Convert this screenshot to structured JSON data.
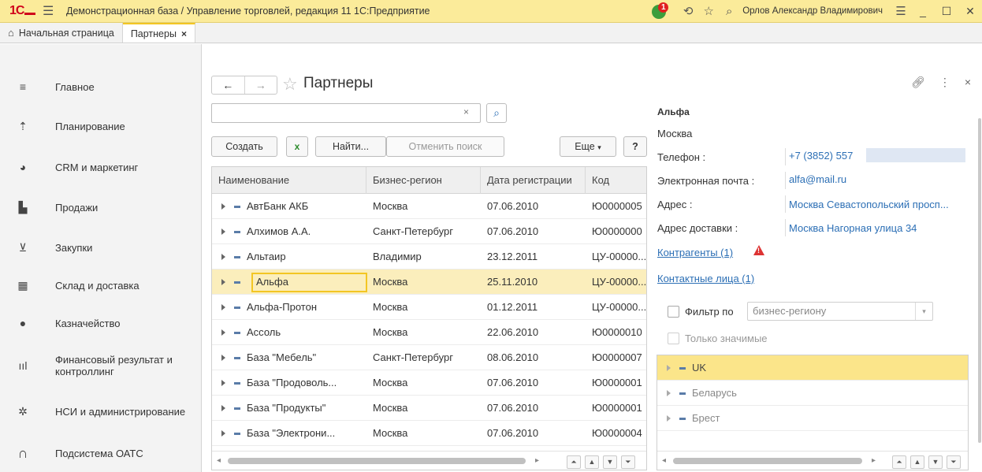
{
  "titlebar": {
    "title": "Демонстрационная база / Управление торговлей, редакция 11 1С:Предприятие",
    "notification_count": "1",
    "user": "Орлов Александр Владимирович"
  },
  "tabs": [
    {
      "label": "Начальная страница"
    },
    {
      "label": "Партнеры"
    }
  ],
  "sidebar": {
    "items": [
      {
        "label": "Главное",
        "icon": "menu-icon"
      },
      {
        "label": "Планирование",
        "icon": "planning-icon"
      },
      {
        "label": "CRM и маркетинг",
        "icon": "pie-chart-icon"
      },
      {
        "label": "Продажи",
        "icon": "bag-icon"
      },
      {
        "label": "Закупки",
        "icon": "cart-icon"
      },
      {
        "label": "Склад и доставка",
        "icon": "warehouse-icon"
      },
      {
        "label": "Казначейство",
        "icon": "coin-icon"
      },
      {
        "label": "Финансовый результат и контроллинг",
        "icon": "bar-chart-icon"
      },
      {
        "label": "НСИ и администрирование",
        "icon": "gear-icon"
      },
      {
        "label": "Подсистема ОАТС",
        "icon": "headset-icon"
      }
    ]
  },
  "form": {
    "title": "Партнеры",
    "search_value": "",
    "buttons": {
      "create": "Создать",
      "find": "Найти...",
      "cancel_search": "Отменить поиск",
      "more": "Еще",
      "help": "?"
    }
  },
  "grid": {
    "columns": [
      "Наименование",
      "Бизнес-регион",
      "Дата регистрации",
      "Код"
    ],
    "rows": [
      {
        "name": "АвтБанк АКБ",
        "region": "Москва",
        "date": "07.06.2010",
        "code": "Ю0000005"
      },
      {
        "name": "Алхимов А.А.",
        "region": "Санкт-Петербург",
        "date": "07.06.2010",
        "code": "Ю0000000"
      },
      {
        "name": "Альтаир",
        "region": "Владимир",
        "date": "23.12.2011",
        "code": "ЦУ-00000..."
      },
      {
        "name": "Альфа",
        "region": "Москва",
        "date": "25.11.2010",
        "code": "ЦУ-00000..."
      },
      {
        "name": "Альфа-Протон",
        "region": "Москва",
        "date": "01.12.2011",
        "code": "ЦУ-00000..."
      },
      {
        "name": "Ассоль",
        "region": "Москва",
        "date": "22.06.2010",
        "code": "Ю0000010"
      },
      {
        "name": "База \"Мебель\"",
        "region": "Санкт-Петербург",
        "date": "08.06.2010",
        "code": "Ю0000007"
      },
      {
        "name": "База \"Продоволь...",
        "region": "Москва",
        "date": "07.06.2010",
        "code": "Ю0000001"
      },
      {
        "name": "База \"Продукты\"",
        "region": "Москва",
        "date": "07.06.2010",
        "code": "Ю0000001"
      },
      {
        "name": "База \"Электрони...",
        "region": "Москва",
        "date": "07.06.2010",
        "code": "Ю0000004"
      }
    ],
    "selected_row": 3
  },
  "details": {
    "title": "Альфа",
    "city": "Москва",
    "phone_label": "Телефон :",
    "phone_value": "+7 (3852) 557",
    "email_label": "Электронная почта :",
    "email_value": "alfa@mail.ru",
    "address_label": "Адрес :",
    "address_value": "Москва Севастопольский просп...",
    "delivery_label": "Адрес доставки :",
    "delivery_value": "Москва Нагорная улица 34",
    "contractors_link": "Контрагенты (1)",
    "contacts_link": "Контактные лица (1)",
    "filter_label": "Фильтр по",
    "filter_value": "бизнес-региону",
    "only_important": "Только значимые",
    "regions": [
      "UK",
      "Беларусь",
      "Брест"
    ]
  }
}
